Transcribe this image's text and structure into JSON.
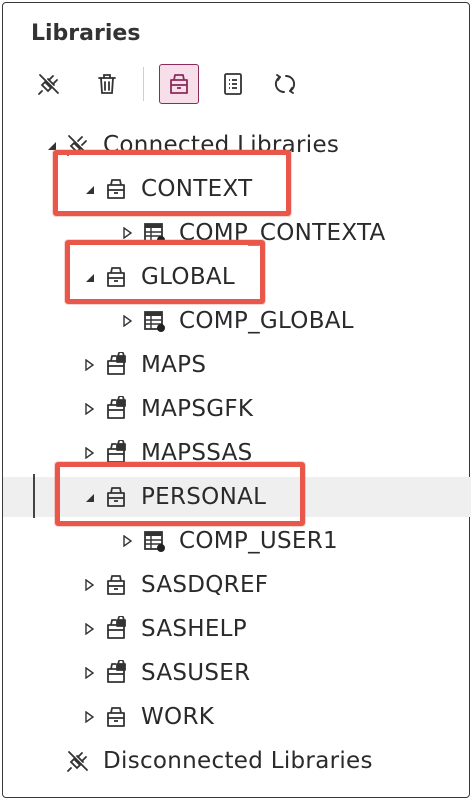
{
  "panel": {
    "title": "Libraries"
  },
  "toolbar": {
    "buttons": [
      {
        "name": "disconnect-library",
        "icon": "plug-disconnect-icon"
      },
      {
        "name": "delete",
        "icon": "trash-icon"
      },
      {
        "name": "new-library",
        "icon": "library-icon",
        "active": true
      },
      {
        "name": "properties",
        "icon": "properties-list-icon"
      },
      {
        "name": "refresh",
        "icon": "refresh-icon"
      }
    ]
  },
  "tree": {
    "connected_label": "Connected Libraries",
    "disconnected_label": "Disconnected Libraries",
    "libraries": [
      {
        "label": "CONTEXT",
        "expanded": true,
        "children": [
          "COMP_CONTEXTA"
        ]
      },
      {
        "label": "GLOBAL",
        "expanded": true,
        "children": [
          "COMP_GLOBAL"
        ]
      },
      {
        "label": "MAPS",
        "expanded": false,
        "locked": true
      },
      {
        "label": "MAPSGFK",
        "expanded": false,
        "locked": true
      },
      {
        "label": "MAPSSAS",
        "expanded": false,
        "locked": true
      },
      {
        "label": "PERSONAL",
        "expanded": true,
        "selected": true,
        "children": [
          "COMP_USER1"
        ]
      },
      {
        "label": "SASDQREF",
        "expanded": false
      },
      {
        "label": "SASHELP",
        "expanded": false,
        "locked": true
      },
      {
        "label": "SASUSER",
        "expanded": false,
        "locked": true
      },
      {
        "label": "WORK",
        "expanded": false
      }
    ]
  },
  "colors": {
    "highlight": "#e8574a",
    "active_button_border": "#8b2a5d",
    "active_button_bg": "#f6dfe9"
  }
}
